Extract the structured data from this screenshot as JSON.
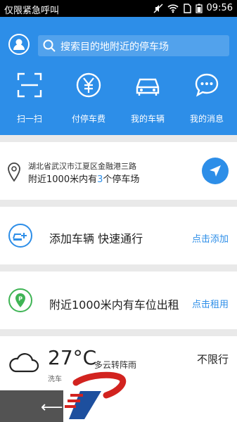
{
  "status_bar": {
    "carrier": "仅限紧急呼叫",
    "time": "09:56",
    "icons": [
      "mute-icon",
      "wifi-icon",
      "sim-icon",
      "battery-icon"
    ]
  },
  "header": {
    "search_placeholder": "搜索目的地附近的停车场",
    "actions": [
      {
        "label": "扫一扫",
        "icon": "scan-icon"
      },
      {
        "label": "付停车费",
        "icon": "yen-icon"
      },
      {
        "label": "我的车辆",
        "icon": "car-icon"
      },
      {
        "label": "我的消息",
        "icon": "chat-icon"
      }
    ]
  },
  "location": {
    "address": "湖北省武汉市江夏区金融港三路",
    "near_prefix": "附近1000米内有",
    "near_count": "3",
    "near_suffix": "个停车场"
  },
  "add_car": {
    "title": "添加车辆  快速通行",
    "link": "点击添加"
  },
  "rent": {
    "title": "附近1000米内有车位出租",
    "link": "点击租用"
  },
  "weather": {
    "temp": "27°C",
    "desc": "多云转阵雨",
    "wash": "洗车",
    "limit": "不限行"
  },
  "colors": {
    "primary": "#2d8ee8",
    "green": "#3fb455"
  }
}
